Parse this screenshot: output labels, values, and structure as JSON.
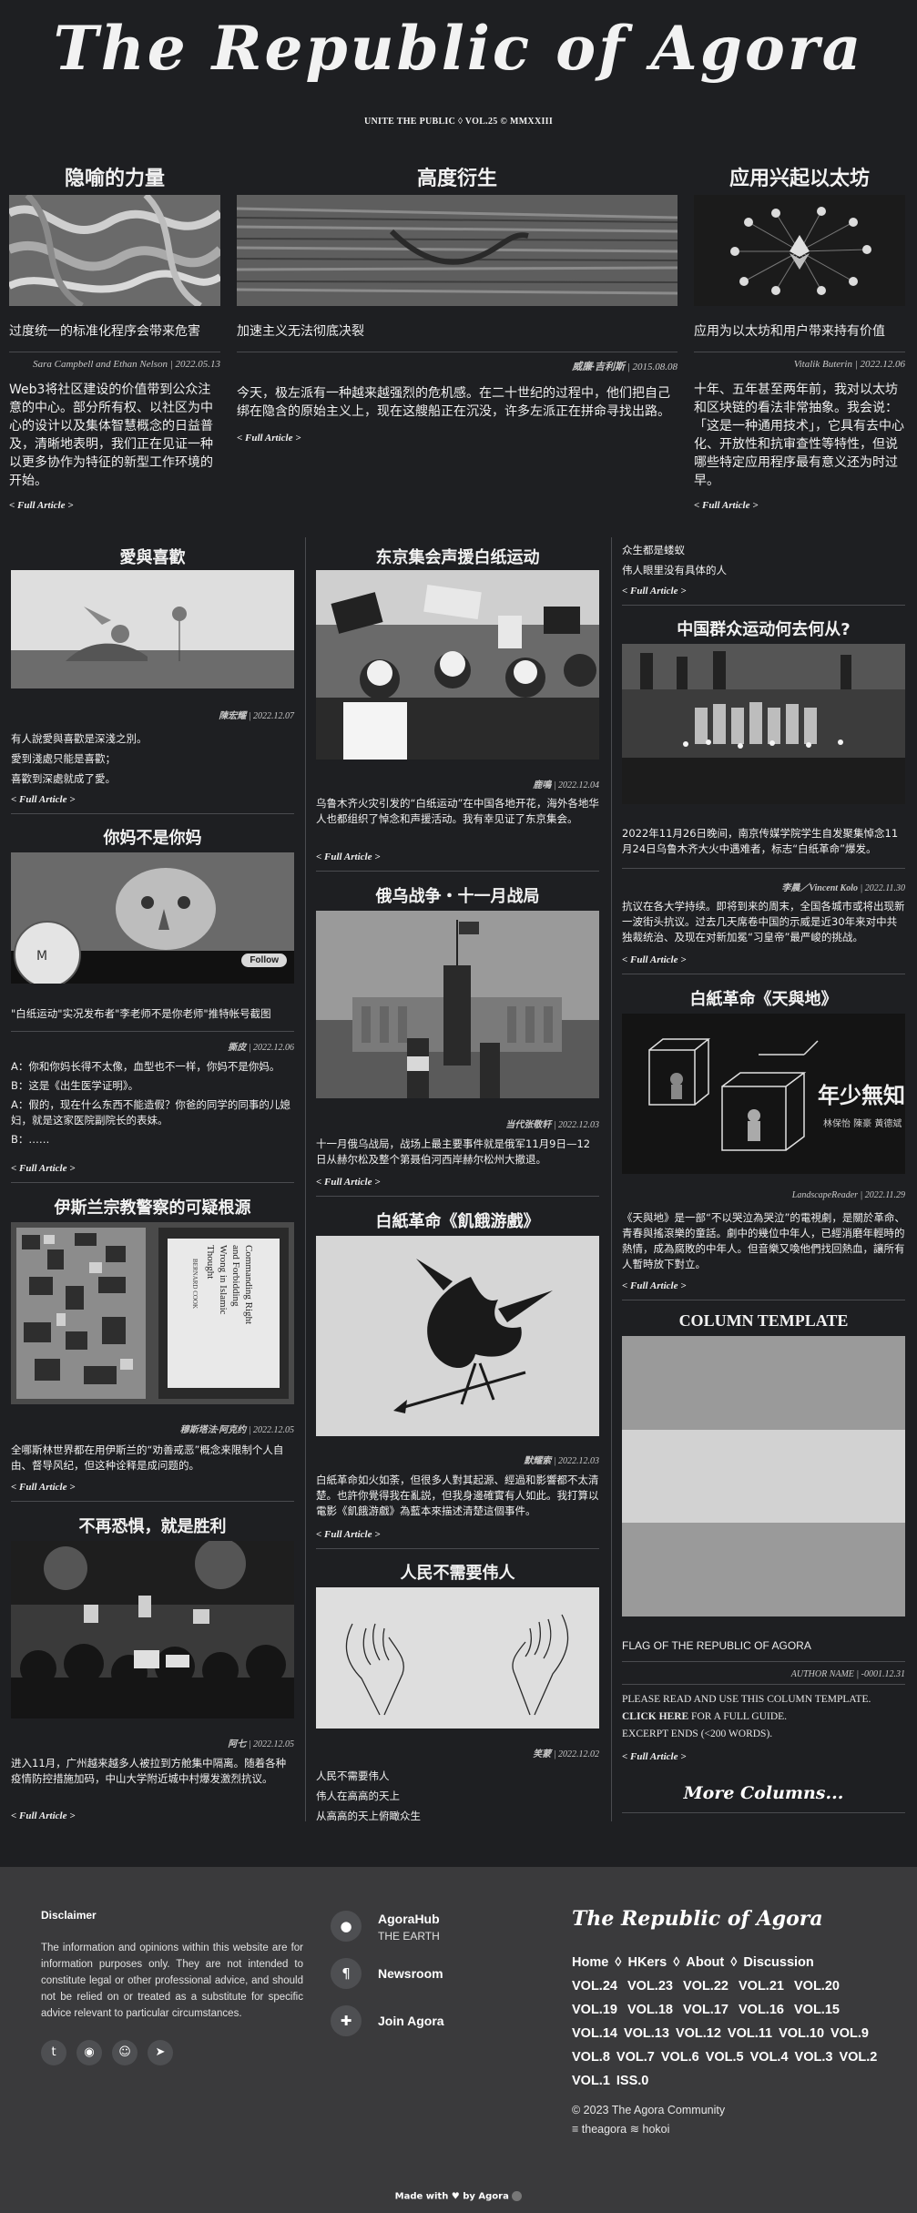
{
  "masthead": {
    "title": "The Republic of Agora",
    "subline": "UNITE THE PUBLIC ◊ VOL.25 © MMXXIII"
  },
  "top": [
    {
      "heading": "隐喻的力量",
      "subtitle": "过度统一的标准化程序会带来危害",
      "byline": "Sara Campbell and Ethan Nelson | 2022.05.13",
      "body": "Web3将社区建设的价值带到公众注意的中心。部分所有权、以社区为中心的设计以及集体智慧概念的日益普及，清晰地表明，我们正在见证一种以更多协作为特征的新型工作环境的开始。",
      "more": "< Full Article >"
    },
    {
      "heading": "高度衍生",
      "subtitle": "加速主义无法彻底决裂",
      "byline_author": "威廉·吉利斯",
      "byline_date": " | 2015.08.08",
      "body": "今天，极左派有一种越来越强烈的危机感。在二十世纪的过程中，他们把自己绑在隐含的原始主义上，现在这艘船正在沉没，许多左派正在拼命寻找出路。",
      "more": "< Full Article >"
    },
    {
      "heading": "应用兴起以太坊",
      "subtitle": "应用为以太坊和用户带来持有价值",
      "byline": "Vitalik Buterin | 2022.12.06",
      "body": "十年、五年甚至两年前，我对以太坊和区块链的看法非常抽象。我会说：「这是一种通用技术」，它具有去中心化、开放性和抗审查性等特性，但说哪些特定应用程序最有意义还为时过早。",
      "more": "< Full Article >"
    }
  ],
  "col1": [
    {
      "heading": "愛與喜歡",
      "byline_author": "陳宏耀",
      "byline_date": " | 2022.12.07",
      "lines": [
        "有人說愛與喜歡是深淺之別。",
        "愛到淺處只能是喜歡；",
        "喜歡到深處就成了愛。"
      ],
      "more": "< Full Article >"
    },
    {
      "heading": "你妈不是你妈",
      "follow": "Follow",
      "caption": "\"白纸运动\"实况发布者\"李老师不是你老师\"推特帐号截图",
      "byline_author": "撕皮",
      "byline_date": " | 2022.12.06",
      "lines": [
        "A：你和你妈长得不太像，血型也不一样，你妈不是你妈。",
        "B：这是《出生医学证明》。",
        "A：假的，现在什么东西不能造假？你爸的同学的同事的儿媳妇，就是这家医院副院长的表妹。",
        "B：……"
      ],
      "more": "< Full Article >"
    },
    {
      "heading": "伊斯兰宗教警察的可疑根源",
      "book_spine": "BERNARD COOK",
      "book_title": "Commanding Right and Forbidding Wrong in Islamic Thought",
      "byline_author": "穆斯塔法·阿克约",
      "byline_date": " | 2022.12.05",
      "body": "全哪斯林世界都在用伊斯兰的“劝善戒恶”概念来限制个人自由、督导风纪，但这种诠释是成问题的。",
      "more": "< Full Article >"
    },
    {
      "heading": "不再恐惧，就是胜利",
      "byline_author": "阿七",
      "byline_date": " | 2022.12.05",
      "body": "进入11月，广州越来越多人被拉到方舱集中隔离。随着各种疫情防控措施加码，中山大学附近城中村爆发激烈抗议。",
      "more": "< Full Article >"
    }
  ],
  "col2": [
    {
      "heading": "东京集会声援白纸运动",
      "byline_author": "鹿鳴",
      "byline_date": " | 2022.12.04",
      "body": "乌鲁木齐火灾引发的“白纸运动”在中国各地开花，海外各地华人也都组织了悼念和声援活动。我有幸见证了东京集会。",
      "more": "< Full Article >"
    },
    {
      "heading": "俄乌战争・十一月战局",
      "byline_author": "当代张敬轩",
      "byline_date": " | 2022.12.03",
      "body": "十一月俄乌战局，战场上最主要事件就是俄军11月9日—12日从赫尔松及整个第聂伯河西岸赫尔松州大撤退。",
      "more": "< Full Article >"
    },
    {
      "heading": "白紙革命《飢餓游戲》",
      "byline_author": "默耀索",
      "byline_date": " | 2022.12.03",
      "body": "白紙革命如火如荼，但很多人對其起源、經過和影響都不太清楚。也許你覺得我在亂説，但我身邊確實有人如此。我打算以電影《飢餓游戲》為藍本來描述清楚這個事件。",
      "more": "< Full Article >"
    },
    {
      "heading": "人民不需要伟人",
      "byline_author": "笑蒙",
      "byline_date": " | 2022.12.02",
      "lines": [
        "人民不需要伟人",
        "伟人在高高的天上",
        "从高高的天上俯瞰众生"
      ]
    }
  ],
  "col3": [
    {
      "top_lines": [
        "众生都是蝼蚁",
        "伟人眼里没有具体的人"
      ],
      "more": "< Full Article >"
    },
    {
      "heading": "中国群众运动何去何从?",
      "caption": "2022年11月26日晚间，南京传媒学院学生自发聚集悼念11月24日乌鲁木齐大火中遇难者，标志“白纸革命”爆发。",
      "byline_author": "李晨／Vincent Kolo",
      "byline_date": " | 2022.11.30",
      "body": "抗议在各大学持续。即将到来的周末，全国各城市或将出现新一波街头抗议。过去几天席卷中国的示威是近30年来对中共独裁统治、及现在对新加冕“习皇帝”最严峻的挑战。",
      "more": "< Full Article >"
    },
    {
      "heading": "白紙革命《天與地》",
      "poster_title": "年少無知",
      "poster_names": "林保怡 陳豪 黃德斌",
      "byline": "LandscapeReader | 2022.11.29",
      "body": "《天與地》是一部“不以哭泣為哭泣”的電視劇，是關於革命、青春與搖滾樂的童話。劇中的幾位中年人，已經消磨年輕時的熱情，成為腐敗的中年人。但音樂又喚他們找回熱血，讓所有人暫時放下對立。",
      "more": "< Full Article >"
    },
    {
      "heading": "COLUMN TEMPLATE",
      "subtitle": "FLAG OF THE REPUBLIC OF AGORA",
      "byline": "AUTHOR NAME | -0001.12.31",
      "body_a": "PLEASE READ AND USE THIS COLUMN TEMPLATE.",
      "click": "CLICK HERE",
      "body_b": " FOR A FULL GUIDE.",
      "body_c": "EXCERPT ENDS (<200 WORDS).",
      "more": "< Full Article >",
      "more_columns": "More Columns..."
    }
  ],
  "footer": {
    "disclaimer_title": "Disclaimer",
    "disclaimer_text": "The information and opinions within this website are for information purposes only. They are not intended to constitute legal or other professional advice, and should not be relied on or treated as a substitute for specific advice relevant to particular circumstances.",
    "social": [
      "twitter-icon",
      "github-icon",
      "reddit-icon",
      "telegram-icon"
    ],
    "nav": [
      {
        "label": "AgoraHub",
        "sub": "THE EARTH",
        "icon": "map-pin-icon"
      },
      {
        "label": "Newsroom",
        "sub": "",
        "icon": "paragraph-icon"
      },
      {
        "label": "Join Agora",
        "sub": "",
        "icon": "puzzle-icon"
      }
    ],
    "brand": "The Republic of Agora",
    "links": [
      "Home",
      "◊",
      "HKers",
      "◊",
      "About",
      "◊",
      "Discussion"
    ],
    "volumes": [
      "VOL.24",
      "VOL.23",
      "VOL.22",
      "VOL.21",
      "VOL.20",
      "VOL.19",
      "VOL.18",
      "VOL.17",
      "VOL.16",
      "VOL.15",
      "VOL.14",
      "VOL.13",
      "VOL.12",
      "VOL.11",
      "VOL.10",
      "VOL.9",
      "VOL.8",
      "VOL.7",
      "VOL.6",
      "VOL.5",
      "VOL.4",
      "VOL.3",
      "VOL.2",
      "VOL.1",
      "ISS.0"
    ],
    "copyright": "© 2023 The Agora Community",
    "tag": "≡ theagora ≋ hokoi",
    "made": "Made with ♥ by Agora"
  }
}
